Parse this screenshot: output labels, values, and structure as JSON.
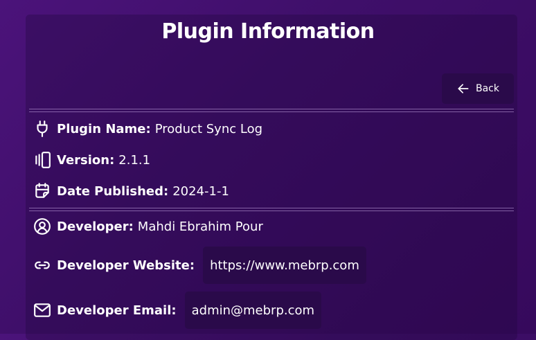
{
  "page": {
    "title": "Plugin Information"
  },
  "toolbar": {
    "back_label": "Back"
  },
  "plugin": {
    "name_label": "Plugin Name:",
    "name_value": "Product Sync Log",
    "version_label": "Version:",
    "version_value": "2.1.1",
    "date_label": "Date Published:",
    "date_value": "2024-1-1"
  },
  "developer": {
    "name_label": "Developer:",
    "name_value": "Mahdi Ebrahim Pour",
    "website_label": "Developer Website:",
    "website_value": "https://www.mebrp.com",
    "email_label": "Developer Email:",
    "email_value": "admin@mebrp.com"
  },
  "icons": {
    "plugin": "plug-icon",
    "version": "versions-icon",
    "date": "calendar-icon",
    "developer": "user-circle-icon",
    "website": "link-icon",
    "email": "mail-icon",
    "back": "arrow-left-icon"
  },
  "colors": {
    "background": "#3f0f6a",
    "button": "#2a0a4a",
    "text": "#ffffff"
  }
}
